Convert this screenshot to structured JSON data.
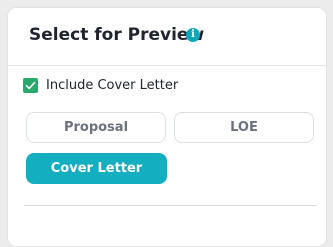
{
  "panel": {
    "title": "Select for Preview",
    "info_icon": "i"
  },
  "include_cover_letter": {
    "label": "Include Cover Letter",
    "checked": true
  },
  "preview_options": [
    {
      "label": "Proposal",
      "selected": false
    },
    {
      "label": "LOE",
      "selected": false
    },
    {
      "label": "Cover Letter",
      "selected": true
    }
  ],
  "colors": {
    "accent": "#13aebf",
    "checkbox": "#26a96a",
    "info": "#0fa7b8"
  }
}
